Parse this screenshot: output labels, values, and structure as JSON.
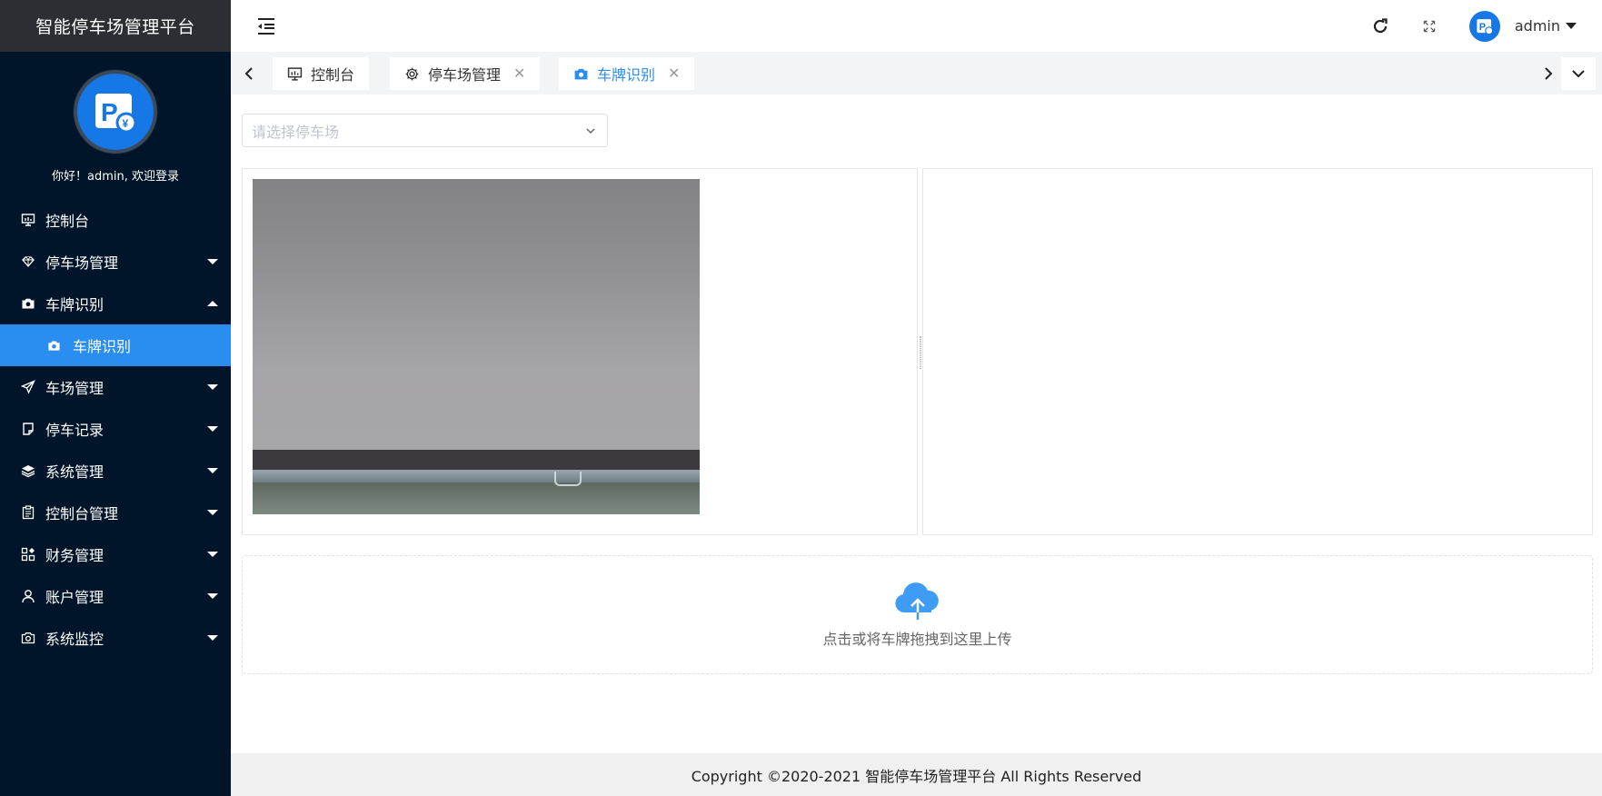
{
  "app": {
    "title": "智能停车场管理平台"
  },
  "profile": {
    "welcome": "你好！admin, 欢迎登录"
  },
  "sidebar": {
    "items": [
      {
        "label": "控制台",
        "icon": "monitor-icon"
      },
      {
        "label": "停车场管理",
        "icon": "diamond-icon"
      },
      {
        "label": "车牌识别",
        "icon": "camera-icon"
      },
      {
        "label": "车场管理",
        "icon": "send-icon"
      },
      {
        "label": "停车记录",
        "icon": "note-icon"
      },
      {
        "label": "系统管理",
        "icon": "layers-icon"
      },
      {
        "label": "控制台管理",
        "icon": "clipboard-icon"
      },
      {
        "label": "财务管理",
        "icon": "apps-icon"
      },
      {
        "label": "账户管理",
        "icon": "user-icon"
      },
      {
        "label": "系统监控",
        "icon": "camera-outline-icon"
      }
    ],
    "sub_active": {
      "label": "车牌识别",
      "icon": "camera-icon"
    }
  },
  "header": {
    "username": "admin"
  },
  "tabs": [
    {
      "label": "控制台",
      "icon": "monitor-icon"
    },
    {
      "label": "停车场管理",
      "icon": "gear-icon"
    },
    {
      "label": "车牌识别",
      "icon": "camera-icon"
    }
  ],
  "main": {
    "select_placeholder": "请选择停车场",
    "upload_text": "点击或将车牌拖拽到这里上传"
  },
  "footer": {
    "copyright": "Copyright ©2020-2021 智能停车场管理平台 All Rights Reserved"
  },
  "colors": {
    "sidebar_bg": "#001529",
    "accent": "#2a8ef0",
    "brand_bg": "#2b2f33"
  }
}
